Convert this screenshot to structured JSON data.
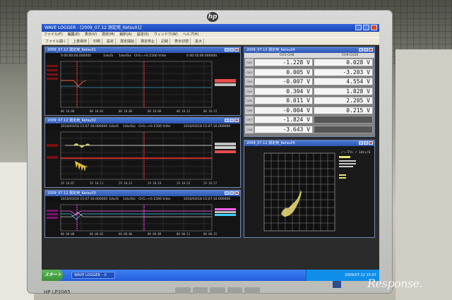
{
  "app": {
    "title": "WAVE LOGGER - [2009_07.12 測定用_Ketsu01]",
    "menu": [
      "ファイル(F)",
      "編集(E)",
      "表示(V)",
      "測定(M)",
      "解析(A)",
      "設定(S)",
      "ウィンドウ(W)",
      "ヘルプ(H)"
    ],
    "toolbar": [
      "ファイル開く",
      "上書保存",
      "印刷",
      "設定",
      "測定開始",
      "測定停止",
      "記録",
      "表示切替",
      "拡大"
    ]
  },
  "windows": {
    "waveform1": {
      "title": "2009_07.12 測定用_Ketsu01",
      "header": {
        "left": "0 00:00:00.000000",
        "mid1": "1div/S",
        "mid2": "1div/S/s",
        "mid3": "CH1=+0.1500 V/div",
        "right": "0 00:10:00.000000"
      },
      "time_labels": [
        "00 10:00",
        "00 10:03",
        "00 10:06",
        "00 10:09",
        "00 10:12",
        "00 10:15"
      ]
    },
    "waveform2": {
      "title": "2009_07.12 測定用_Ketsu02",
      "header": {
        "left": "2010/03/18 15:07:16.000000",
        "mid1": "1div/S",
        "mid2": "1div/S/s",
        "mid3": "CH1=+0.1500 V/div",
        "right": "2010/03/18 15:07:16.000000"
      },
      "time_labels": [
        "29 10:07",
        "29 10:11",
        "29 10:15",
        "29 10:19",
        "29 10:23",
        "29 10:27"
      ]
    },
    "waveform3": {
      "title": "2009_07.12 測定用_Ketsu03",
      "header": {
        "left": "2010/03/18 15:07:16.000000",
        "mid1": "1div/S",
        "mid2": "1div/S/s",
        "mid3": "CH1=+0.1500 V/div",
        "right": "2010/03/18 15:07:16.000000"
      },
      "time_labels": [
        "00 00:00",
        "00 00:03",
        "00 00:06",
        "00 00:09",
        "00 00:12",
        "00 00:15"
      ]
    },
    "meter": {
      "title": "2009_07.12 測定用_Ketsu04",
      "col_left": "CH1-CH8",
      "col_right": "CH9-CH16",
      "rows": [
        {
          "label": "CH1",
          "left": "-1.228 V",
          "right": "0.028 V"
        },
        {
          "label": "CH2",
          "left": "0.005 V",
          "right": "-3.203 V"
        },
        {
          "label": "CH3",
          "left": "-0.007 V",
          "right": "4.554 V"
        },
        {
          "label": "CH4",
          "left": "0.304 V",
          "right": "1.828 V"
        },
        {
          "label": "CH5",
          "left": "0.011 V",
          "right": "2.205 V"
        },
        {
          "label": "CH6",
          "left": "-0.004 V",
          "right": "0.215 V"
        },
        {
          "label": "CH7",
          "left": "-1.824 V",
          "right": ""
        },
        {
          "label": "CH8",
          "left": "-3.643 V",
          "right": ""
        }
      ]
    },
    "xy": {
      "title": "2009_07.12 測定用_Ketsu05",
      "legend_header": "ノーマル / 1div/S"
    }
  },
  "taskbar": {
    "start": "スタート",
    "task": "WAVE LOGGER - ①",
    "clock": "2009/07.12  15:07"
  },
  "monitor": {
    "brand": "hp",
    "model": "HP LP2065"
  },
  "watermark": "Response."
}
